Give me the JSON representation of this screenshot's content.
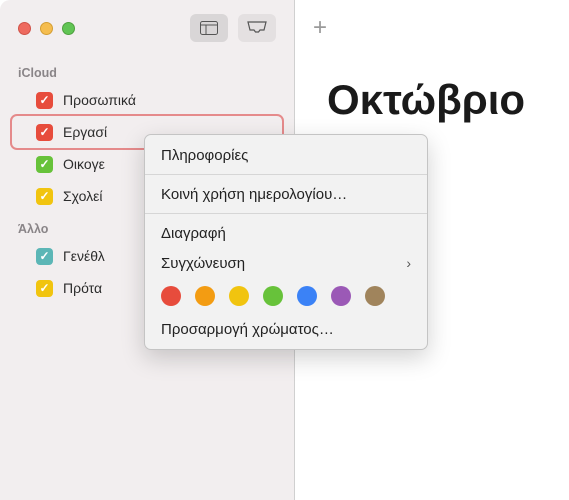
{
  "toolbar": {},
  "sidebar": {
    "groups": [
      {
        "header": "iCloud",
        "items": [
          {
            "label": "Προσωπικά",
            "color": "red"
          },
          {
            "label": "Εργασί",
            "color": "red",
            "selected": true
          },
          {
            "label": "Οικογε",
            "color": "green"
          },
          {
            "label": "Σχολεί",
            "color": "yellow"
          }
        ]
      },
      {
        "header": "Άλλο",
        "items": [
          {
            "label": "Γενέθλ",
            "color": "teal"
          },
          {
            "label": "Πρότα",
            "color": "yellow"
          }
        ]
      }
    ]
  },
  "main": {
    "month_title": "Οκτώβριο"
  },
  "context_menu": {
    "items": [
      {
        "label": "Πληροφορίες"
      },
      {
        "sep": true
      },
      {
        "label": "Κοινή χρήση ημερολογίου…"
      },
      {
        "sep": true
      },
      {
        "label": "Διαγραφή"
      },
      {
        "label": "Συγχώνευση",
        "submenu": true
      },
      {
        "colors": [
          "red",
          "orange",
          "yellow",
          "green",
          "blue",
          "purple",
          "brown"
        ]
      },
      {
        "label": "Προσαρμογή χρώματος…"
      }
    ]
  }
}
